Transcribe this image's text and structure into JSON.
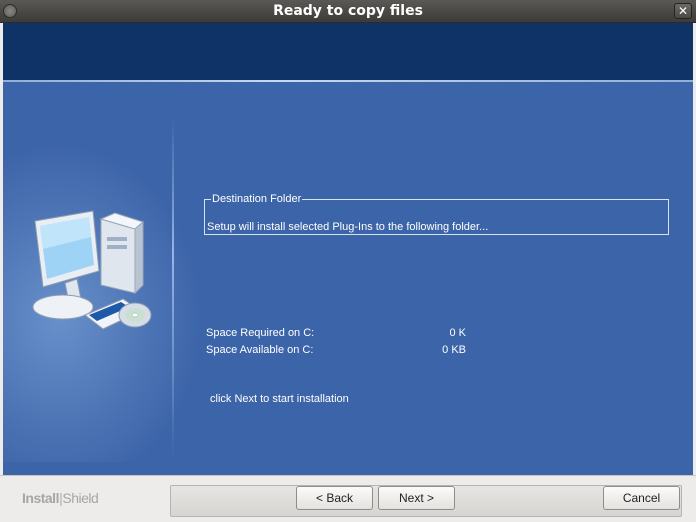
{
  "window": {
    "title": "Ready to copy files",
    "close_glyph": "✕"
  },
  "content": {
    "intro": "Setup will install selected Plug-Ins to the following folder...",
    "destination_label": "Destination Folder",
    "destination_value": "",
    "space_required_label": "Space Required on C:",
    "space_required_value": "0 K",
    "space_available_label": "Space Available on C:",
    "space_available_value": "0 KB",
    "hint": "click Next to start installation"
  },
  "footer": {
    "brand_left": "Install",
    "brand_right": "Shield",
    "back_label": "< Back",
    "next_label": "Next >",
    "cancel_label": "Cancel"
  },
  "colors": {
    "banner": "#0f3366",
    "content_bg": "#3c64a8",
    "titlebar": "#3c3b37"
  }
}
